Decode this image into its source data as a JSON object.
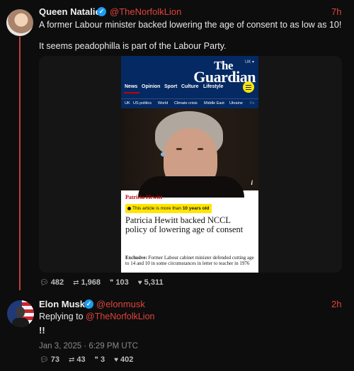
{
  "thread": {
    "post1": {
      "display_name": "Queen Natalie",
      "handle": "@TheNorfolkLion",
      "time": "7h",
      "text_line1": "A former Labour minister backed lowering the age of consent to as low as 10!",
      "text_line2": "It seems peadophilla is part of the Labour Party.",
      "stats": {
        "replies": "482",
        "reposts": "1,968",
        "quotes": "103",
        "likes": "5,311"
      }
    },
    "post2": {
      "display_name": "Elon Musk",
      "handle": "@elonmusk",
      "time": "2h",
      "replying_prefix": "Replying to",
      "replying_handle": "@TheNorfolkLion",
      "text": "!!",
      "date": "Jan 3, 2025 · 6:29 PM UTC",
      "stats": {
        "replies": "73",
        "reposts": "43",
        "quotes": "3",
        "likes": "402"
      }
    }
  },
  "article": {
    "edition": "UK ▾",
    "logo_line1": "The",
    "logo_line2": "Guardian",
    "nav": [
      "News",
      "Opinion",
      "Sport",
      "Culture",
      "Lifestyle"
    ],
    "subnav": [
      "UK",
      "US politics",
      "World",
      "Climate crisis",
      "Middle East",
      "Ukraine",
      "Fo"
    ],
    "kicker": "Patricia Hewitt",
    "age_prefix": "This article is more than",
    "age_bold": "10 years old",
    "headline": "Patricia Hewitt backed NCCL policy of lowering age of consent",
    "standfirst_bold": "Exclusive:",
    "standfirst": "Former Labour cabinet minister defended cutting age to 14 and 10 in some circumstances in letter to teacher in 1976",
    "image_info": "i"
  },
  "icons": {
    "verified": "verified-badge-icon",
    "reply": "reply-icon",
    "repost": "repost-icon",
    "quote": "quote-icon",
    "like": "heart-icon"
  },
  "colors": {
    "background": "#0d0d0d",
    "accent": "#e0433c",
    "verified": "#1d9bf0",
    "guardian_blue": "#052962",
    "guardian_yellow": "#ffe500"
  }
}
